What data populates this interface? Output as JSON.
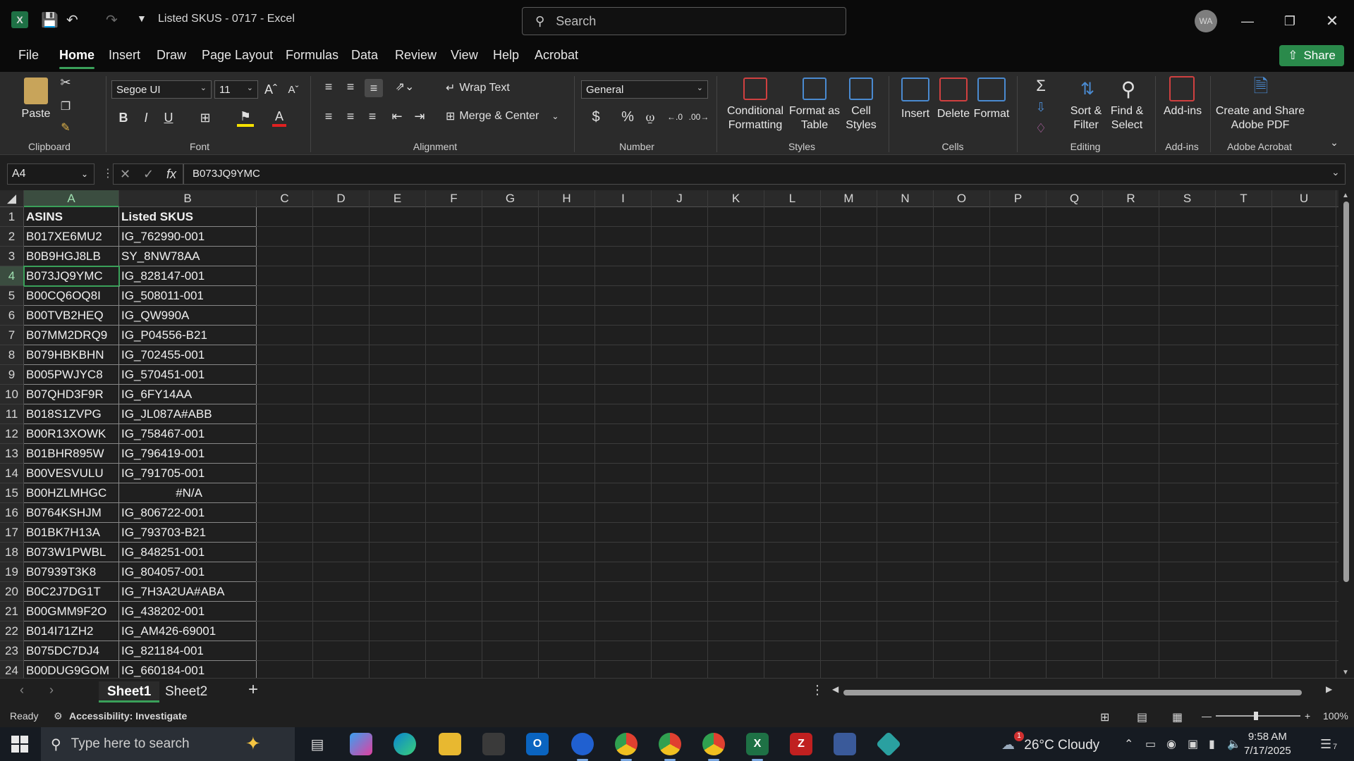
{
  "titlebar": {
    "app_letter": "X",
    "doc_title": "Listed SKUS - 0717  -  Excel",
    "search_placeholder": "Search",
    "avatar_initials": "WA"
  },
  "ribbon_tabs": [
    "File",
    "Home",
    "Insert",
    "Draw",
    "Page Layout",
    "Formulas",
    "Data",
    "Review",
    "View",
    "Help",
    "Acrobat"
  ],
  "active_tab": "Home",
  "share_label": "Share",
  "ribbon": {
    "clipboard": {
      "paste": "Paste",
      "label": "Clipboard"
    },
    "font": {
      "name": "Segoe UI",
      "size": "11",
      "label": "Font"
    },
    "alignment": {
      "wrap_text": "Wrap Text",
      "merge_center": "Merge & Center",
      "label": "Alignment"
    },
    "number": {
      "format": "General",
      "label": "Number"
    },
    "styles": {
      "conditional": [
        "Conditional",
        "Formatting"
      ],
      "format_table": [
        "Format as",
        "Table"
      ],
      "cell_styles": [
        "Cell",
        "Styles"
      ],
      "label": "Styles"
    },
    "cells": {
      "insert": "Insert",
      "delete": "Delete",
      "format": "Format",
      "label": "Cells"
    },
    "editing": {
      "sort_filter": [
        "Sort &",
        "Filter"
      ],
      "find_select": [
        "Find &",
        "Select"
      ],
      "label": "Editing"
    },
    "addins": {
      "button": "Add-ins",
      "label": "Add-ins"
    },
    "acrobat": {
      "button": [
        "Create and Share",
        "Adobe PDF"
      ],
      "label": "Adobe Acrobat"
    }
  },
  "formula_bar": {
    "name_box": "A4",
    "fx": "fx",
    "value": "B073JQ9YMC"
  },
  "columns": [
    "A",
    "B",
    "C",
    "D",
    "E",
    "F",
    "G",
    "H",
    "I",
    "J",
    "K",
    "L",
    "M",
    "N",
    "O",
    "P",
    "Q",
    "R",
    "S",
    "T",
    "U"
  ],
  "selected_cell": "A4",
  "table": {
    "headers": [
      "ASINS",
      "Listed SKUS"
    ],
    "rows": [
      [
        "B017XE6MU2",
        "IG_762990-001"
      ],
      [
        "B0B9HGJ8LB",
        "SY_8NW78AA"
      ],
      [
        "B073JQ9YMC",
        "IG_828147-001"
      ],
      [
        "B00CQ6OQ8I",
        "IG_508011-001"
      ],
      [
        "B00TVB2HEQ",
        "IG_QW990A"
      ],
      [
        "B07MM2DRQ9",
        "IG_P04556-B21"
      ],
      [
        "B079HBKBHN",
        "IG_702455-001"
      ],
      [
        "B005PWJYC8",
        "IG_570451-001"
      ],
      [
        "B07QHD3F9R",
        "IG_6FY14AA"
      ],
      [
        "B018S1ZVPG",
        "IG_JL087A#ABB"
      ],
      [
        "B00R13XOWK",
        "IG_758467-001"
      ],
      [
        "B01BHR895W",
        "IG_796419-001"
      ],
      [
        "B00VESVULU",
        "IG_791705-001"
      ],
      [
        "B00HZLMHGC",
        "#N/A"
      ],
      [
        "B0764KSHJM",
        "IG_806722-001"
      ],
      [
        "B01BK7H13A",
        "IG_793703-B21"
      ],
      [
        "B073W1PWBL",
        "IG_848251-001"
      ],
      [
        "B07939T3K8",
        "IG_804057-001"
      ],
      [
        "B0C2J7DG1T",
        "IG_7H3A2UA#ABA"
      ],
      [
        "B00GMM9F2O",
        "IG_438202-001"
      ],
      [
        "B014I71ZH2",
        "IG_AM426-69001"
      ],
      [
        "B075DC7DJ4",
        "IG_821184-001"
      ],
      [
        "B00DUG9GOM",
        "IG_660184-001"
      ]
    ]
  },
  "sheet_tabs": [
    "Sheet1",
    "Sheet2"
  ],
  "active_sheet": "Sheet1",
  "status": {
    "ready": "Ready",
    "accessibility": "Accessibility: Investigate",
    "zoom": "100%"
  },
  "taskbar": {
    "search_placeholder": "Type here to search",
    "weather": "26°C  Cloudy",
    "weather_badge": "1",
    "time": "9:58 AM",
    "date": "7/17/2025",
    "notification_count": "7"
  },
  "colors": {
    "accent_green": "#3aa05a",
    "excel_green": "#1e7145",
    "share_green": "#2a8a4b"
  }
}
